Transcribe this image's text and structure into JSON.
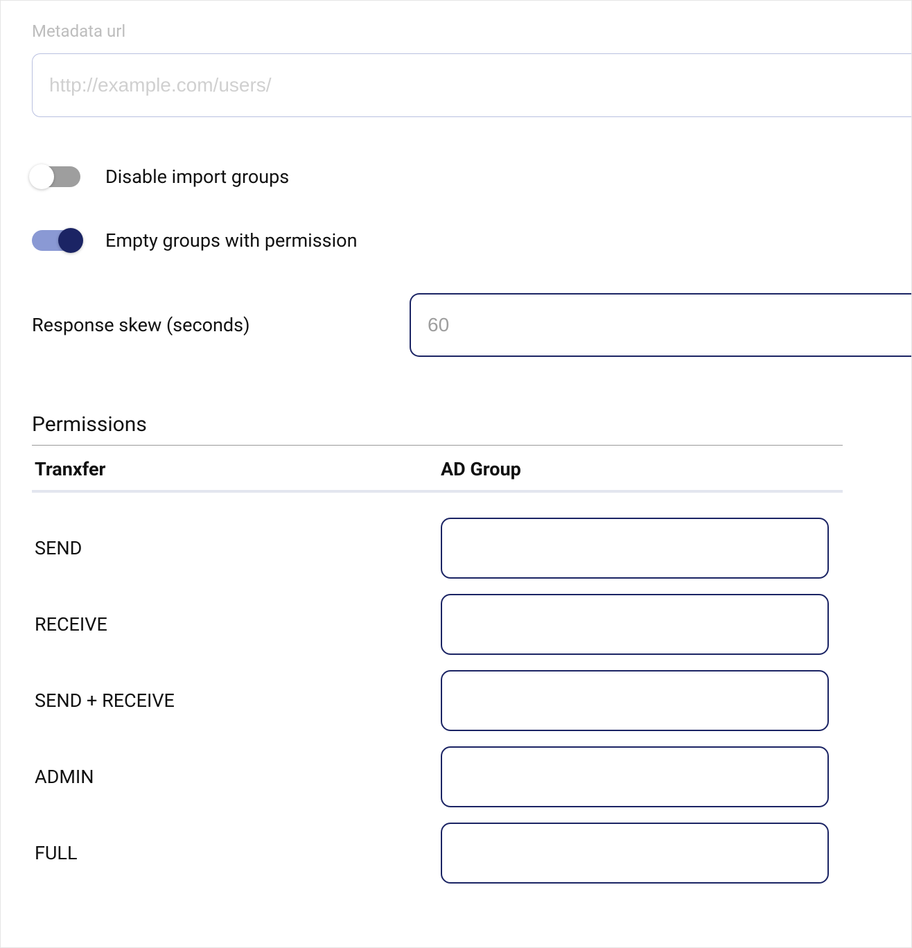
{
  "metadata": {
    "label": "Metadata url",
    "placeholder": "http://example.com/users/",
    "value": ""
  },
  "toggles": {
    "disable_import_groups": {
      "label": "Disable import groups",
      "on": false
    },
    "empty_groups_with_permission": {
      "label": "Empty groups with permission",
      "on": true
    }
  },
  "response_skew": {
    "label": "Response skew (seconds)",
    "placeholder": "60",
    "value": ""
  },
  "permissions": {
    "heading": "Permissions",
    "columns": {
      "tranxfer": "Tranxfer",
      "ad_group": "AD Group"
    },
    "rows": [
      {
        "label": "SEND",
        "value": ""
      },
      {
        "label": "RECEIVE",
        "value": ""
      },
      {
        "label": "SEND + RECEIVE",
        "value": ""
      },
      {
        "label": "ADMIN",
        "value": ""
      },
      {
        "label": "FULL",
        "value": ""
      }
    ]
  }
}
